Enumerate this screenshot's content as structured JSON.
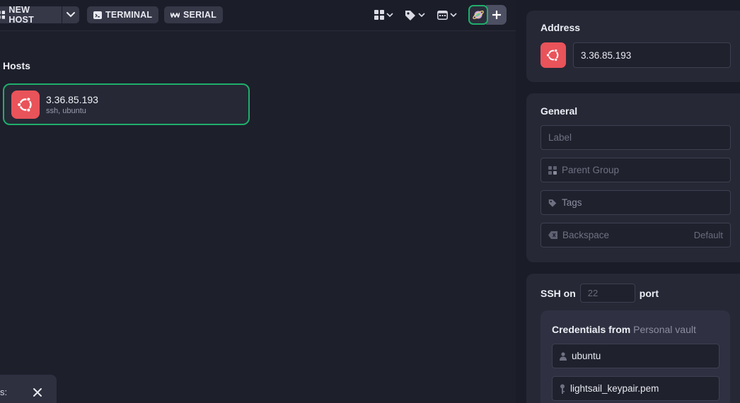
{
  "toolbar": {
    "new_host_label": "NEW HOST",
    "terminal_label": "TERMINAL",
    "serial_label": "SERIAL"
  },
  "hosts_section": {
    "title": "Hosts",
    "items": [
      {
        "name": "3.36.85.193",
        "subtitle": "ssh, ubuntu",
        "os_icon": "ubuntu-icon"
      }
    ]
  },
  "toast": {
    "text": "s:"
  },
  "address_panel": {
    "title": "Address",
    "value": "3.36.85.193"
  },
  "general_panel": {
    "title": "General",
    "label_placeholder": "Label",
    "parent_group_placeholder": "Parent Group",
    "tags_placeholder": "Tags",
    "backspace_label": "Backspace",
    "backspace_value": "Default"
  },
  "ssh_panel": {
    "ssh_on": "SSH on",
    "port_placeholder": "22",
    "port_label": "port",
    "credentials_title": "Credentials from",
    "credentials_source": "Personal vault",
    "username": "ubuntu",
    "key": "lightsail_keypair.pem"
  },
  "colors": {
    "accent_green": "#1fae6b",
    "ubuntu_red": "#e9535a",
    "background": "#1d1f2b"
  }
}
